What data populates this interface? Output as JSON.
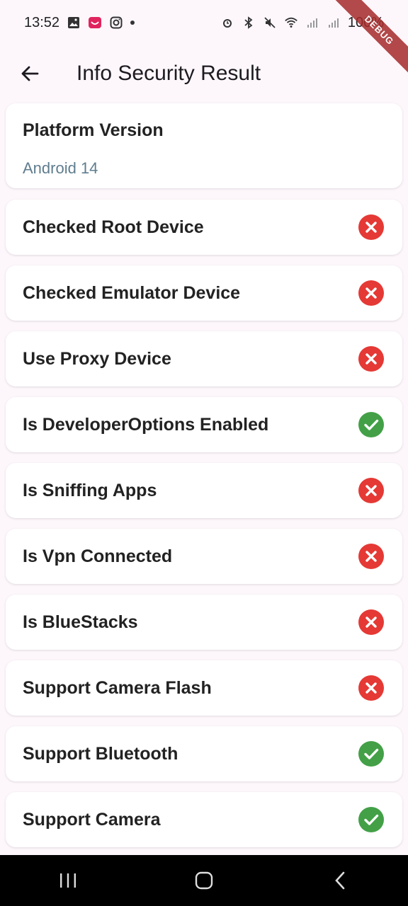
{
  "status_bar": {
    "time": "13:52",
    "battery": "100%"
  },
  "debug_banner": "DEBUG",
  "app_bar": {
    "title": "Info Security Result"
  },
  "platform": {
    "title": "Platform Version",
    "value": "Android 14"
  },
  "checks": [
    {
      "label": "Checked Root Device",
      "status": "fail"
    },
    {
      "label": "Checked Emulator Device",
      "status": "fail"
    },
    {
      "label": "Use Proxy Device",
      "status": "fail"
    },
    {
      "label": "Is DeveloperOptions Enabled",
      "status": "pass"
    },
    {
      "label": "Is Sniffing Apps",
      "status": "fail"
    },
    {
      "label": "Is Vpn Connected",
      "status": "fail"
    },
    {
      "label": "Is BlueStacks",
      "status": "fail"
    },
    {
      "label": "Support Camera Flash",
      "status": "fail"
    },
    {
      "label": "Support Bluetooth",
      "status": "pass"
    },
    {
      "label": "Support Camera",
      "status": "pass"
    }
  ],
  "colors": {
    "pass": "#43a047",
    "fail": "#e53935"
  },
  "icons": {
    "pass": "check-circle-icon",
    "fail": "cancel-circle-icon"
  }
}
